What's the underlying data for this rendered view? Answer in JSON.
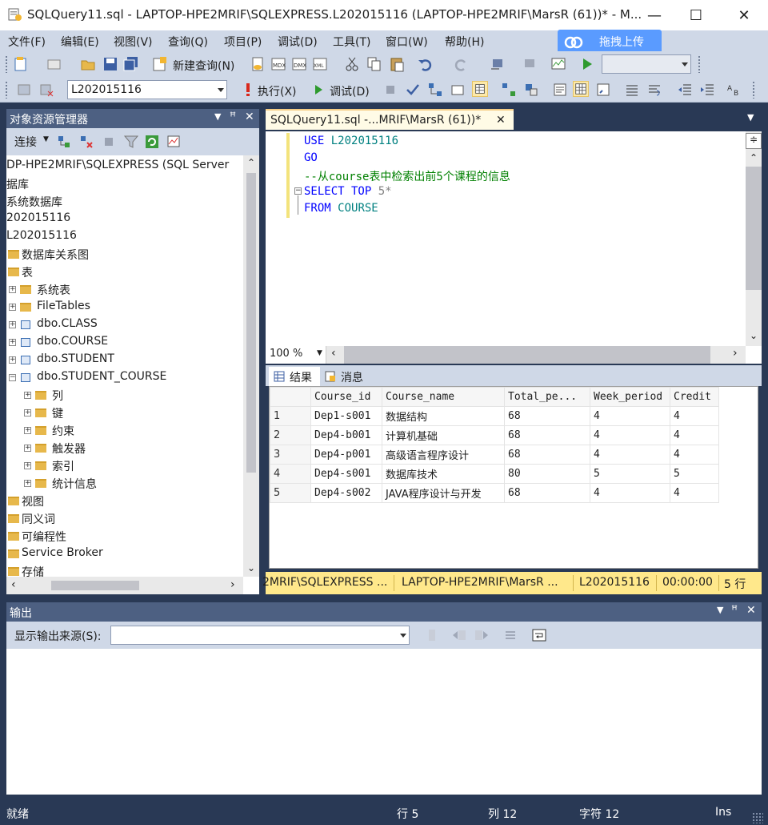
{
  "window": {
    "title": "SQLQuery11.sql - LAPTOP-HPE2MRIF\\SQLEXPRESS.L202015116 (LAPTOP-HPE2MRIF\\MarsR (61))* - M...",
    "minimize": "—",
    "maximize": "☐",
    "close": "✕"
  },
  "menu": [
    "文件(F)",
    "编辑(E)",
    "视图(V)",
    "查询(Q)",
    "项目(P)",
    "调试(D)",
    "工具(T)",
    "窗口(W)",
    "帮助(H)"
  ],
  "upload_button": "拖拽上传",
  "toolbar": {
    "new_query": "新建查询(N)",
    "database_select": "L202015116",
    "execute": "执行(X)",
    "debug": "调试(D)"
  },
  "object_explorer": {
    "title": "对象资源管理器",
    "connect": "连接",
    "tree": [
      "DP-HPE2MRIF\\SQLEXPRESS (SQL Server",
      "据库",
      "系统数据库",
      "202015116",
      "L202015116",
      "数据库关系图",
      "表",
      "系统表",
      "FileTables",
      "dbo.CLASS",
      "dbo.COURSE",
      "dbo.STUDENT",
      "dbo.STUDENT_COURSE",
      "列",
      "键",
      "约束",
      "触发器",
      "索引",
      "统计信息",
      "视图",
      "同义词",
      "可编程性",
      "Service Broker",
      "存储"
    ]
  },
  "doc_tab": {
    "label": "SQLQuery11.sql -...MRIF\\MarsR (61))*",
    "close": "✕"
  },
  "editor": {
    "line1_kw": "USE",
    "line1_db": "L202015116",
    "line2_kw": "GO",
    "line3_comment": "--从course表中检索出前5个课程的信息",
    "line4_kw": "SELECT TOP",
    "line4_rest": "5*",
    "line5_kw": "FROM",
    "line5_tbl": "COURSE",
    "zoom": "100 %"
  },
  "result_tabs": {
    "results": "结果",
    "messages": "消息"
  },
  "grid": {
    "columns": [
      "Course_id",
      "Course_name",
      "Total_pe...",
      "Week_period",
      "Credit"
    ],
    "rows": [
      [
        "1",
        "Dep1-s001",
        "数据结构",
        "68",
        "4",
        "4"
      ],
      [
        "2",
        "Dep4-b001",
        "计算机基础",
        "68",
        "4",
        "4"
      ],
      [
        "3",
        "Dep4-p001",
        "高级语言程序设计",
        "68",
        "4",
        "4"
      ],
      [
        "4",
        "Dep4-s001",
        "数据库技术",
        "80",
        "5",
        "5"
      ],
      [
        "5",
        "Dep4-s002",
        "JAVA程序设计与开发",
        "68",
        "4",
        "4"
      ]
    ]
  },
  "query_status": {
    "server": "2MRIF\\SQLEXPRESS ...",
    "user": "LAPTOP-HPE2MRIF\\MarsR ...",
    "database": "L202015116",
    "time": "00:00:00",
    "rows": "5 行"
  },
  "output": {
    "title": "输出",
    "source_label": "显示输出来源(S):"
  },
  "statusbar": {
    "ready": "就绪",
    "line": "行 5",
    "col": "列 12",
    "char": "字符 12",
    "mode": "Ins"
  },
  "colors": {
    "frame": "#293955",
    "pane_header": "#4d6082",
    "toolbar": "#cfd8e7",
    "status_yellow": "#ffe88b",
    "keyword": "#0000ff",
    "comment": "#008000"
  }
}
